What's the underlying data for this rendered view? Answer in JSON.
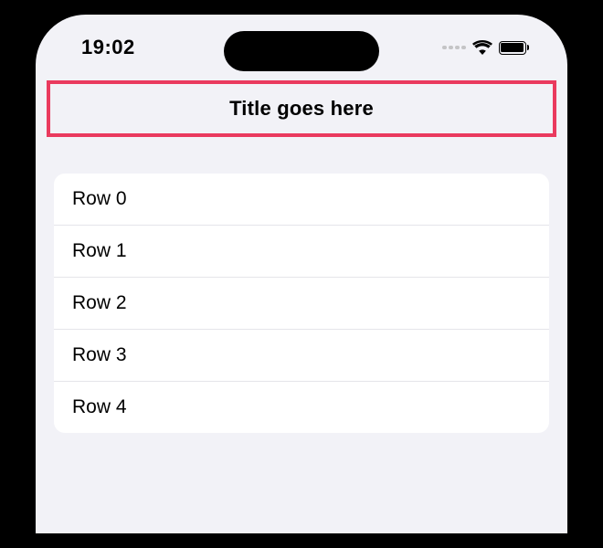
{
  "statusBar": {
    "time": "19:02"
  },
  "navBar": {
    "title": "Title goes here",
    "highlightColor": "#ea3a5e"
  },
  "list": {
    "rows": [
      {
        "label": "Row 0"
      },
      {
        "label": "Row 1"
      },
      {
        "label": "Row 2"
      },
      {
        "label": "Row 3"
      },
      {
        "label": "Row 4"
      }
    ]
  }
}
